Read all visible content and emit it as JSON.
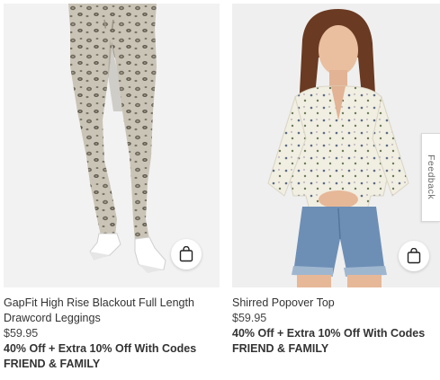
{
  "products": [
    {
      "name": "GapFit High Rise Blackout Full Length Drawcord Leggings",
      "price": "$59.95",
      "promo_line1": "40% Off + Extra 10% Off With Codes",
      "promo_line2": "FRIEND & FAMILY",
      "image": "leopard-print-leggings-photo",
      "bag_icon": "shopping-bag-icon"
    },
    {
      "name": "Shirred Popover Top",
      "price": "$59.95",
      "promo_line1": "40% Off + Extra 10% Off With Codes",
      "promo_line2": "FRIEND & FAMILY",
      "image": "shirred-popover-top-photo",
      "bag_icon": "shopping-bag-icon"
    }
  ],
  "feedback": {
    "label": "Feedback"
  },
  "colors": {
    "image_background": "#f2f2f2",
    "text": "#333333"
  }
}
